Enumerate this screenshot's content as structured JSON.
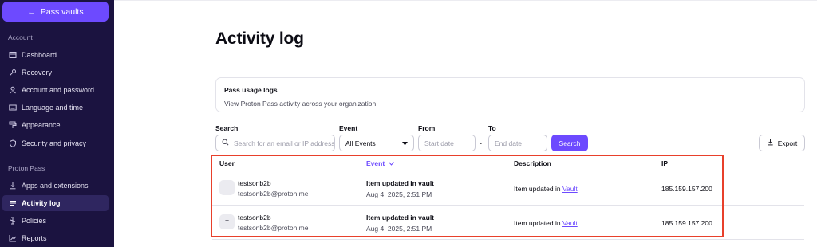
{
  "sidebar": {
    "back_label": "Pass vaults",
    "section_account": "Account",
    "account_items": [
      {
        "label": "Dashboard",
        "icon": "dashboard-icon"
      },
      {
        "label": "Recovery",
        "icon": "key-icon"
      },
      {
        "label": "Account and password",
        "icon": "user-icon"
      },
      {
        "label": "Language and time",
        "icon": "keyboard-icon"
      },
      {
        "label": "Appearance",
        "icon": "paint-roller-icon"
      },
      {
        "label": "Security and privacy",
        "icon": "shield-icon"
      }
    ],
    "section_pass": "Proton Pass",
    "pass_items": [
      {
        "label": "Apps and extensions",
        "icon": "download-icon"
      },
      {
        "label": "Activity log",
        "icon": "list-icon",
        "active": true
      },
      {
        "label": "Policies",
        "icon": "policy-icon"
      },
      {
        "label": "Reports",
        "icon": "chart-icon"
      }
    ]
  },
  "main": {
    "title": "Activity log",
    "card": {
      "title": "Pass usage logs",
      "description": "View Proton Pass activity across your organization."
    },
    "filters": {
      "search_label": "Search",
      "search_placeholder": "Search for an email or IP address",
      "event_label": "Event",
      "event_value": "All Events",
      "from_label": "From",
      "from_placeholder": "Start date",
      "to_label": "To",
      "to_placeholder": "End date",
      "search_button": "Search",
      "export_button": "Export"
    },
    "table": {
      "headers": {
        "user": "User",
        "event": "Event",
        "description": "Description",
        "ip": "IP"
      },
      "rows": [
        {
          "avatar": "T",
          "user_name": "testsonb2b",
          "user_email": "testsonb2b@proton.me",
          "event": "Item updated in vault",
          "time": "Aug 4, 2025, 2:51 PM",
          "desc_prefix": "Item updated in ",
          "desc_link": "Vault",
          "ip": "185.159.157.200"
        },
        {
          "avatar": "T",
          "user_name": "testsonb2b",
          "user_email": "testsonb2b@proton.me",
          "event": "Item updated in vault",
          "time": "Aug 4, 2025, 2:51 PM",
          "desc_prefix": "Item updated in ",
          "desc_link": "Vault",
          "ip": "185.159.157.200"
        }
      ]
    }
  },
  "colors": {
    "accent": "#6d4aff",
    "sidebar_bg": "#1b1340",
    "highlight": "#e8402b"
  }
}
